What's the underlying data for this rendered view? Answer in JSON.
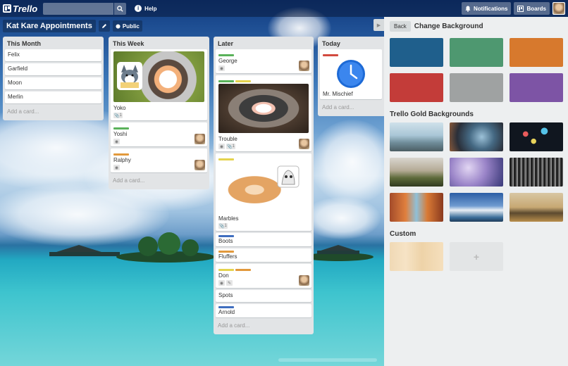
{
  "app": {
    "logo_text": "Trello"
  },
  "topbar": {
    "search_placeholder": "",
    "help_label": "Help",
    "help_glyph": "i",
    "notifications_label": "Notifications",
    "boards_label": "Boards"
  },
  "board": {
    "title": "Kat Kare Appointments",
    "visibility_label": "Public"
  },
  "lists": [
    {
      "title": "This Month",
      "cards": [
        "Felix",
        "Garfield",
        "Moon",
        "Merlin"
      ],
      "add_label": "Add a card..."
    },
    {
      "title": "This Week",
      "cards": [
        {
          "title": "Yoko",
          "attachments": "1"
        },
        {
          "title": "Yoshi"
        },
        {
          "title": "Ralphy"
        }
      ],
      "add_label": "Add a card..."
    },
    {
      "title": "Later",
      "cards": [
        {
          "title": "George"
        },
        {
          "title": "Trouble",
          "attachments": "1"
        },
        {
          "title": "Marbles",
          "attachments": "1"
        },
        {
          "title": "Boots"
        },
        {
          "title": "Fluffers"
        },
        {
          "title": "Don"
        },
        {
          "title": "Spots"
        },
        {
          "title": "Arnold"
        }
      ],
      "add_label": "Add a card..."
    },
    {
      "title": "Today",
      "cards": [
        {
          "title": "Mr. Mischief"
        }
      ],
      "add_label": "Add a card..."
    }
  ],
  "panel": {
    "back_label": "Back",
    "title": "Change Background",
    "colors": [
      "#1f5f8c",
      "#4e9870",
      "#d7792d",
      "#c33c39",
      "#9fa2a2",
      "#7d54a5"
    ],
    "gold_heading": "Trello Gold Backgrounds",
    "custom_heading": "Custom",
    "custom_add_glyph": "+"
  },
  "label_colors": {
    "green": "#5ab25a",
    "yellow": "#e5d34e",
    "orange": "#e2993c",
    "blue": "#3f6ebf",
    "red": "#d24a3f"
  }
}
